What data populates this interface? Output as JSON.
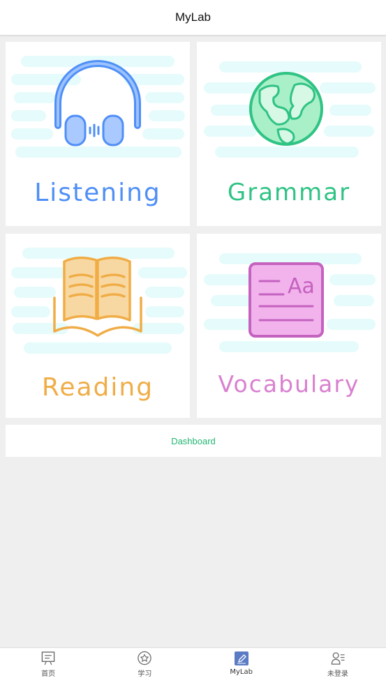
{
  "header": {
    "title": "MyLab"
  },
  "cards": {
    "listening": {
      "label": "Listening",
      "color": "#4f8ff7"
    },
    "grammar": {
      "label": "Grammar",
      "color": "#2fc384"
    },
    "reading": {
      "label": "Reading",
      "color": "#f0ad47"
    },
    "vocabulary": {
      "label": "Vocabulary",
      "color": "#d980d0",
      "icon_text": "Aa"
    }
  },
  "dashboard": {
    "label": "Dashboard",
    "color": "#22b573"
  },
  "tabbar": {
    "items": [
      {
        "label": "首页",
        "icon": "presentation-board-icon"
      },
      {
        "label": "学习",
        "icon": "star-circle-icon"
      },
      {
        "label": "MyLab",
        "icon": "pencil-square-icon",
        "active": true
      },
      {
        "label": "未登录",
        "icon": "user-list-icon"
      }
    ]
  }
}
